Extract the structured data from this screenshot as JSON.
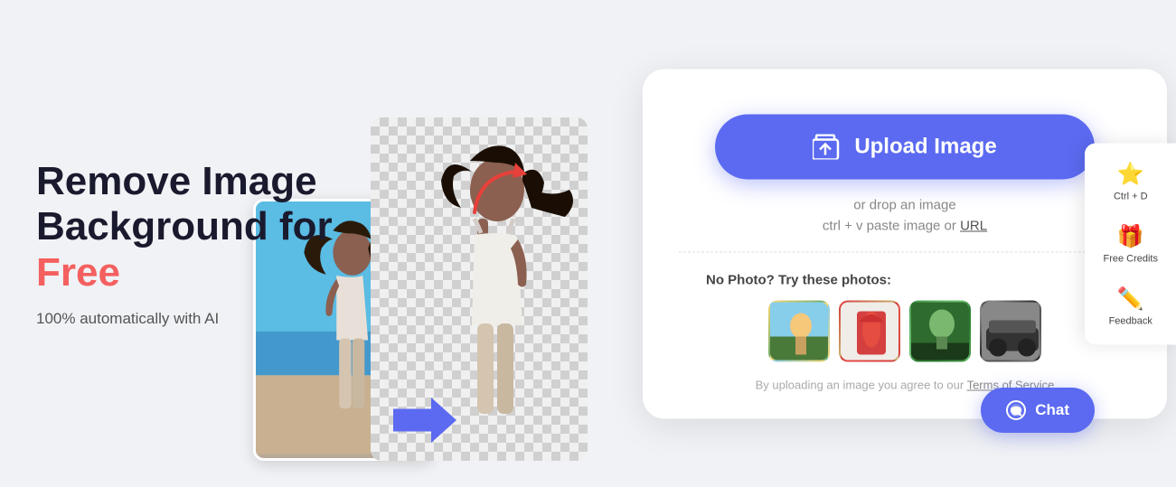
{
  "headline": {
    "line1": "Remove Image",
    "line2": "Background for ",
    "free": "Free"
  },
  "subtitle": "100% automatically with AI",
  "upload_button": "Upload Image",
  "drop_text": "or drop an image",
  "paste_text": "ctrl + v paste image or ",
  "paste_url": "URL",
  "try_photos_label": "No Photo? Try these photos:",
  "tos_text": "By uploading an image you agree to our ",
  "tos_link": "Terms of Service",
  "side_panel": {
    "bookmark": {
      "icon": "⭐",
      "label": "Ctrl + D"
    },
    "gift": {
      "icon": "🎁",
      "label": "Free Credits"
    },
    "feedback": {
      "icon": "✏️",
      "label": "Feedback"
    }
  },
  "chat_button": "Chat",
  "colors": {
    "brand": "#5b6af0",
    "free_color": "#f4605f",
    "headline_dark": "#1a1a2e"
  }
}
